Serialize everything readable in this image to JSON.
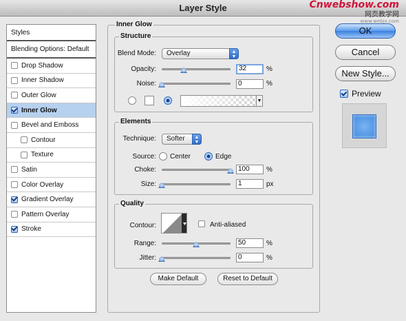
{
  "window": {
    "title": "Layer Style"
  },
  "watermark": {
    "line1": "Cnwebshow.com",
    "line2": "网页教学网",
    "line3": "www.webjx.com"
  },
  "styles_panel": {
    "header": "Styles",
    "blending": "Blending Options: Default",
    "items": [
      {
        "label": "Drop Shadow",
        "checked": false,
        "selected": false,
        "sub": false
      },
      {
        "label": "Inner Shadow",
        "checked": false,
        "selected": false,
        "sub": false
      },
      {
        "label": "Outer Glow",
        "checked": false,
        "selected": false,
        "sub": false
      },
      {
        "label": "Inner Glow",
        "checked": true,
        "selected": true,
        "sub": false
      },
      {
        "label": "Bevel and Emboss",
        "checked": false,
        "selected": false,
        "sub": false
      },
      {
        "label": "Contour",
        "checked": false,
        "selected": false,
        "sub": true
      },
      {
        "label": "Texture",
        "checked": false,
        "selected": false,
        "sub": true
      },
      {
        "label": "Satin",
        "checked": false,
        "selected": false,
        "sub": false
      },
      {
        "label": "Color Overlay",
        "checked": false,
        "selected": false,
        "sub": false
      },
      {
        "label": "Gradient Overlay",
        "checked": true,
        "selected": false,
        "sub": false
      },
      {
        "label": "Pattern Overlay",
        "checked": false,
        "selected": false,
        "sub": false
      },
      {
        "label": "Stroke",
        "checked": true,
        "selected": false,
        "sub": false
      }
    ]
  },
  "inner_glow": {
    "title": "Inner Glow",
    "structure": {
      "title": "Structure",
      "blend_mode_label": "Blend Mode:",
      "blend_mode_value": "Overlay",
      "opacity_label": "Opacity:",
      "opacity_value": "32",
      "opacity_level": 0.32,
      "opacity_unit": "%",
      "noise_label": "Noise:",
      "noise_value": "0",
      "noise_level": 0,
      "noise_unit": "%",
      "fill_mode": "gradient"
    },
    "elements": {
      "title": "Elements",
      "technique_label": "Technique:",
      "technique_value": "Softer",
      "source_label": "Source:",
      "source_center": "Center",
      "source_edge": "Edge",
      "source_selected": "edge",
      "choke_label": "Choke:",
      "choke_value": "100",
      "choke_level": 1,
      "choke_unit": "%",
      "size_label": "Size:",
      "size_value": "1",
      "size_level": 0.004,
      "size_unit": "px"
    },
    "quality": {
      "title": "Quality",
      "contour_label": "Contour:",
      "anti_aliased_label": "Anti-aliased",
      "anti_aliased": false,
      "range_label": "Range:",
      "range_value": "50",
      "range_level": 0.5,
      "range_unit": "%",
      "jitter_label": "Jitter:",
      "jitter_value": "0",
      "jitter_level": 0,
      "jitter_unit": "%"
    },
    "make_default": "Make Default",
    "reset_default": "Reset to Default"
  },
  "buttons": {
    "ok": "OK",
    "cancel": "Cancel",
    "new_style": "New Style...",
    "preview_label": "Preview",
    "preview_checked": true
  },
  "colors": {
    "accent": "#3b80e0",
    "selected_row": "#b6d0ef",
    "preview_swatch": "#4a90e2"
  }
}
